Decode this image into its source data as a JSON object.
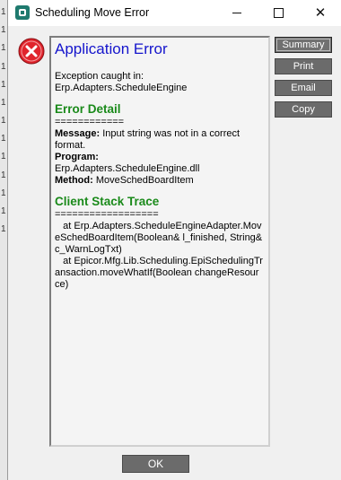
{
  "window": {
    "title": "Scheduling Move Error",
    "app_icon": "epicor-icon"
  },
  "background_rows": [
    "1",
    "1",
    "1",
    "1",
    "1",
    "1",
    "1",
    "1",
    "1",
    "1",
    "1",
    "1",
    "1"
  ],
  "error_icon": "error-circle-icon",
  "content": {
    "app_error_heading": "Application Error",
    "exception_line1": "Exception caught in:",
    "exception_line2": "Erp.Adapters.ScheduleEngine",
    "error_detail_heading": "Error Detail",
    "error_detail_rule": "============",
    "message_label": "Message:",
    "message_value": " Input string was not in a correct format.",
    "program_label": "Program:",
    "program_value": "Erp.Adapters.ScheduleEngine.dll",
    "method_label": "Method:",
    "method_value": " MoveSchedBoardItem",
    "stack_heading": "Client Stack Trace",
    "stack_rule": "==================",
    "stack_line1": "   at Erp.Adapters.ScheduleEngineAdapter.MoveSchedBoardItem(Boolean& l_finished, String& c_WarnLogTxt)",
    "stack_line2": "   at Epicor.Mfg.Lib.Scheduling.EpiSchedulingTransaction.moveWhatIf(Boolean changeResource)"
  },
  "buttons": {
    "summary": "Summary",
    "print": "Print",
    "email": "Email",
    "copy": "Copy",
    "ok": "OK"
  },
  "colors": {
    "heading_blue": "#1515cc",
    "section_green": "#1a8a1a",
    "button_gray": "#6b6b6b",
    "error_red": "#e0242c"
  }
}
